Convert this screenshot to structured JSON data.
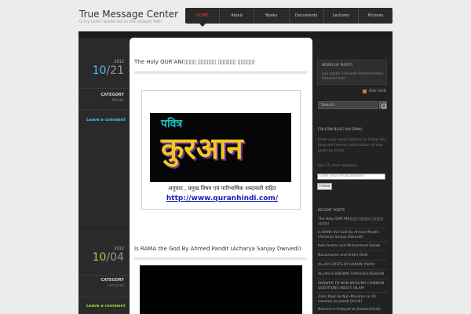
{
  "site": {
    "title": "True Message Center",
    "tagline": "O my Lord ! Guide me to the straight Path"
  },
  "nav": [
    "HOME",
    "About",
    "Books",
    "Documents",
    "Lectures",
    "Pictures"
  ],
  "posts": [
    {
      "year": "2012",
      "month": "10",
      "day": "21",
      "category_label": "CATEGORY",
      "category": "Books",
      "comment": "Leave a comment",
      "title": "The Holy QUR'AN(▯▯▯▯ ▯▯▯▯▯▯ ▯▯▯▯▯▯ ▯▯▯▯▯)",
      "image": {
        "line1": "पवित्र",
        "line2": "कुरआन",
        "subtitle": "अनुवाद , प्रमुख विषय एवं पारिभाषिक शब्दावली सहित",
        "url": "http://www.quranhindi.com/"
      }
    },
    {
      "year": "2012",
      "month": "10",
      "day": "04",
      "category_label": "CATEGORY",
      "category": "Lectures",
      "comment": "Leave a comment",
      "title": "Is RAMA the God By Ahmed Pandit (Acharya Sanjay Dwivedi)"
    }
  ],
  "sidebar": {
    "word_title": "WORD OF PURITY",
    "word_body": "Laa Ilaaha il-lal-laah Muhammadur Rasoolul-laah",
    "rss": "RSS FEED",
    "search_placeholder": "Search",
    "follow_title": "FOLLOW BLOG VIA EMAIL",
    "follow_body": "Enter your email address to follow this blog and receive notifications of new posts by email.",
    "followers": "Join 21 other followers",
    "email_placeholder": "Enter your email address",
    "follow_button": "Follow",
    "recent_title": "RECENT POSTS",
    "recent": [
      "The Holy QUR'AN(▯▯▯▯ ▯▯▯▯▯▯ ▯▯▯▯▯▯ ▯▯▯▯▯)",
      "Is RAMA the God By Ahmed Pandit (Acharya Sanjay Dwivedi)",
      "Kabi Avatar and Muhammad Saheb",
      "Narashansh and Antim Rishi",
      "ALLAH EXISTS BY HARUN YAHYA",
      "ALLAH IS KNOWN THROUGH REASON",
      "ANSWER TO NON-MUSLIMS COMMON QUESTIONS ABOUT ISLAM",
      "Zakir Naik ke Non-Muslims se 20 sawalon ke jawab [Hindi]",
      "Nassem-e-Hidayat ke Jhonke(Hindi)"
    ]
  }
}
